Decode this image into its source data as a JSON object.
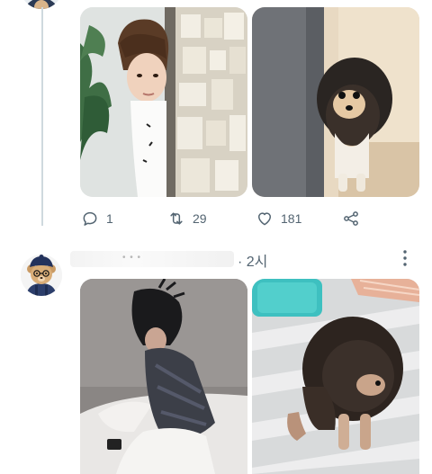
{
  "tweet_prev": {
    "stats": {
      "replies": "1",
      "retweets": "29",
      "likes": "181"
    }
  },
  "tweet_next": {
    "time": "· 2시"
  },
  "icons": {
    "reply": "comment-icon",
    "retweet": "retweet-icon",
    "like": "heart-icon",
    "share": "share-icon",
    "more": "more-dots-icon"
  },
  "colors": {
    "muted_text": "#536471",
    "thread_line": "#cfd9de"
  }
}
